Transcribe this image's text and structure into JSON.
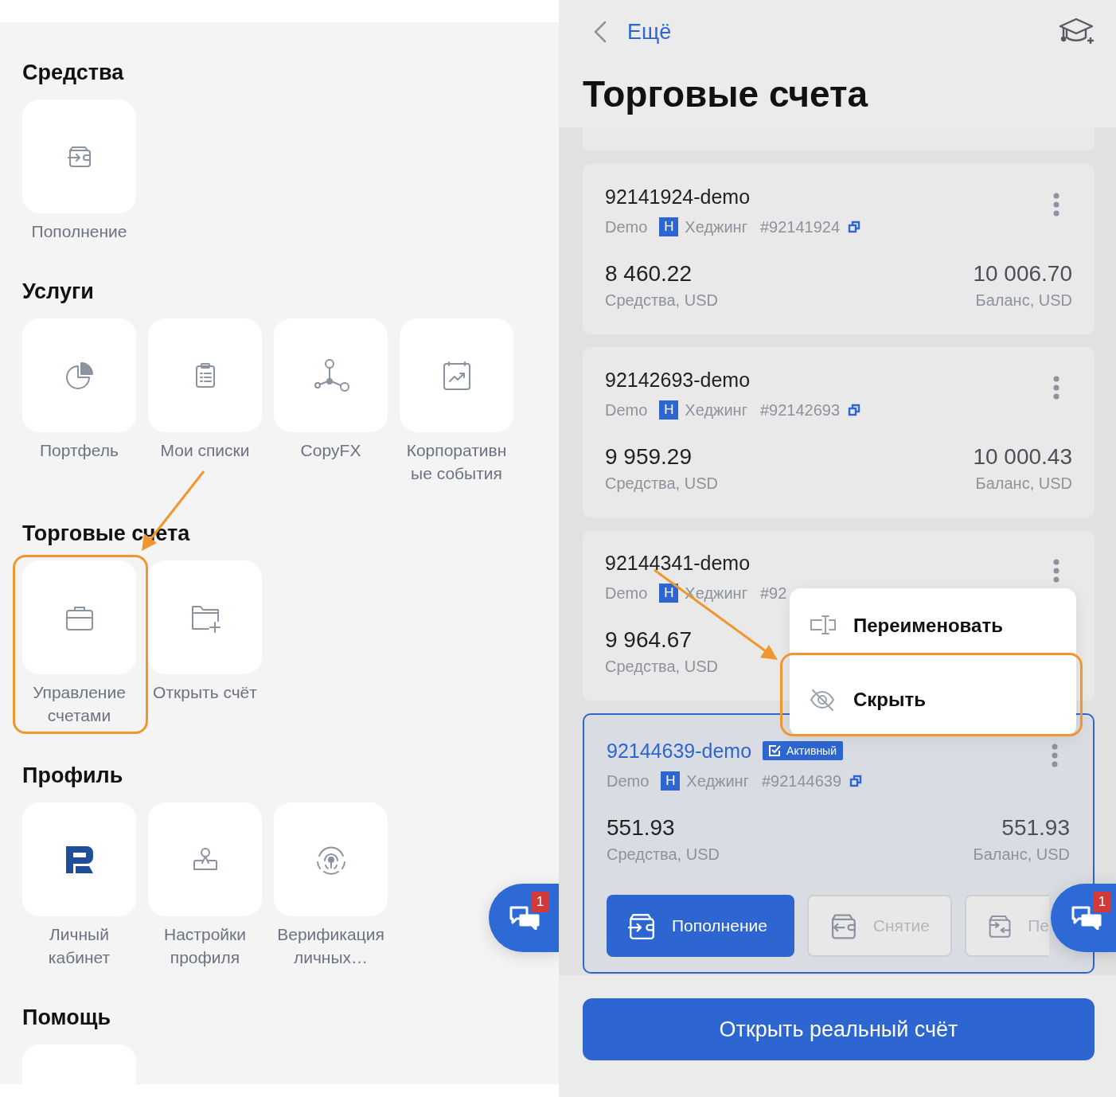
{
  "left_panel": {
    "sections": [
      {
        "title": "Средства",
        "tiles": [
          {
            "kind": "deposit",
            "label": "Пополнение",
            "highlighted": false
          }
        ]
      },
      {
        "title": "Услуги",
        "tiles": [
          {
            "kind": "portfolio",
            "label": "Портфель",
            "highlighted": false
          },
          {
            "kind": "lists",
            "label": "Мои списки",
            "highlighted": false
          },
          {
            "kind": "copyfx",
            "label": "CopyFX",
            "highlighted": false
          },
          {
            "kind": "events",
            "label": "Корпоративные события",
            "highlighted": false
          }
        ]
      },
      {
        "title": "Торговые счета",
        "tiles": [
          {
            "kind": "accounts",
            "label": "Управление счетами",
            "highlighted": true
          },
          {
            "kind": "open",
            "label": "Открыть счёт",
            "highlighted": false
          }
        ]
      },
      {
        "title": "Профиль",
        "tiles": [
          {
            "kind": "cabinet",
            "label": "Личный кабинет",
            "highlighted": false
          },
          {
            "kind": "settings",
            "label": "Настройки профиля",
            "highlighted": false
          },
          {
            "kind": "verify",
            "label": "Верификация личных…",
            "highlighted": false
          }
        ]
      },
      {
        "title": "Помощь",
        "tiles": [
          {
            "kind": "blank",
            "highlighted": false
          }
        ]
      }
    ],
    "chat_badge": "1"
  },
  "right_panel": {
    "back_label": "Ещё",
    "title": "Торговые счета",
    "accounts": [
      {
        "name": "92141924-demo",
        "active": false,
        "type": "Demo",
        "mode_badge": "H",
        "mode": "Хеджинг",
        "number": "#92141924",
        "copy_icon": true,
        "equity": "8 460.22",
        "equity_label": "Средства, USD",
        "balance": "10 006.70",
        "balance_label": "Баланс, USD"
      },
      {
        "name": "92142693-demo",
        "active": false,
        "type": "Demo",
        "mode_badge": "H",
        "mode": "Хеджинг",
        "number": "#92142693",
        "copy_icon": true,
        "equity": "9 959.29",
        "equity_label": "Средства, USD",
        "balance": "10 000.43",
        "balance_label": "Баланс, USD"
      },
      {
        "name": "92144341-demo",
        "active": false,
        "type": "Demo",
        "mode_badge": "H",
        "mode": "Хеджинг",
        "number": "#92",
        "copy_icon": false,
        "equity": "9 964.67",
        "equity_label": "Средства, USD"
      },
      {
        "name": "92144639-demo",
        "active": true,
        "active_badge": "Активный",
        "type": "Demo",
        "mode_badge": "H",
        "mode": "Хеджинг",
        "number": "#92144639",
        "copy_icon": true,
        "equity": "551.93",
        "equity_label": "Средства, USD",
        "balance": "551.93",
        "balance_label": "Баланс, USD",
        "actions": [
          {
            "kind": "deposit",
            "label": "Пополнение",
            "primary": true
          },
          {
            "kind": "withdraw",
            "label": "Снятие",
            "primary": false
          },
          {
            "kind": "transfer",
            "label": "Пе",
            "primary": false
          }
        ]
      }
    ],
    "context_menu": {
      "items": [
        {
          "kind": "rename",
          "label": "Переименовать",
          "highlighted": false
        },
        {
          "kind": "hide",
          "label": "Скрыть",
          "highlighted": true
        }
      ]
    },
    "open_real_button": "Открыть реальный счёт",
    "chat_badge": "1"
  }
}
